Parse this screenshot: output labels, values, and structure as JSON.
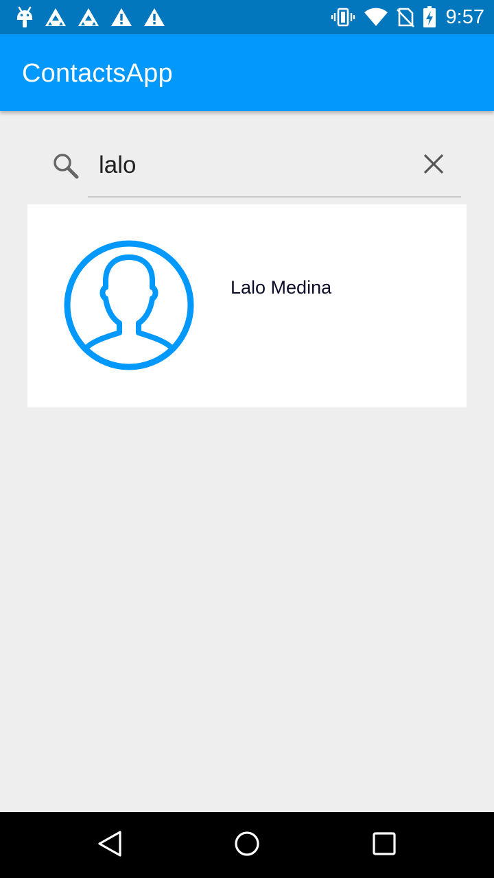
{
  "status_bar": {
    "time": "9:57",
    "left_icons": [
      "android-debug-icon",
      "triangle-pattern-icon",
      "triangle-pattern-icon",
      "warning-icon",
      "warning-icon"
    ],
    "right_icons": [
      "vibrate-icon",
      "wifi-icon",
      "no-sim-icon",
      "battery-charging-icon"
    ]
  },
  "app_bar": {
    "title": "ContactsApp",
    "color": "#0398fc"
  },
  "search": {
    "value": "lalo",
    "icon": "search-icon",
    "clear_icon": "close-icon"
  },
  "contacts": [
    {
      "name": "Lalo Medina",
      "avatar_icon": "person-avatar-icon",
      "avatar_color": "#0398fc"
    }
  ],
  "nav_bar": {
    "buttons": [
      "back-icon",
      "home-icon",
      "recents-icon"
    ]
  }
}
